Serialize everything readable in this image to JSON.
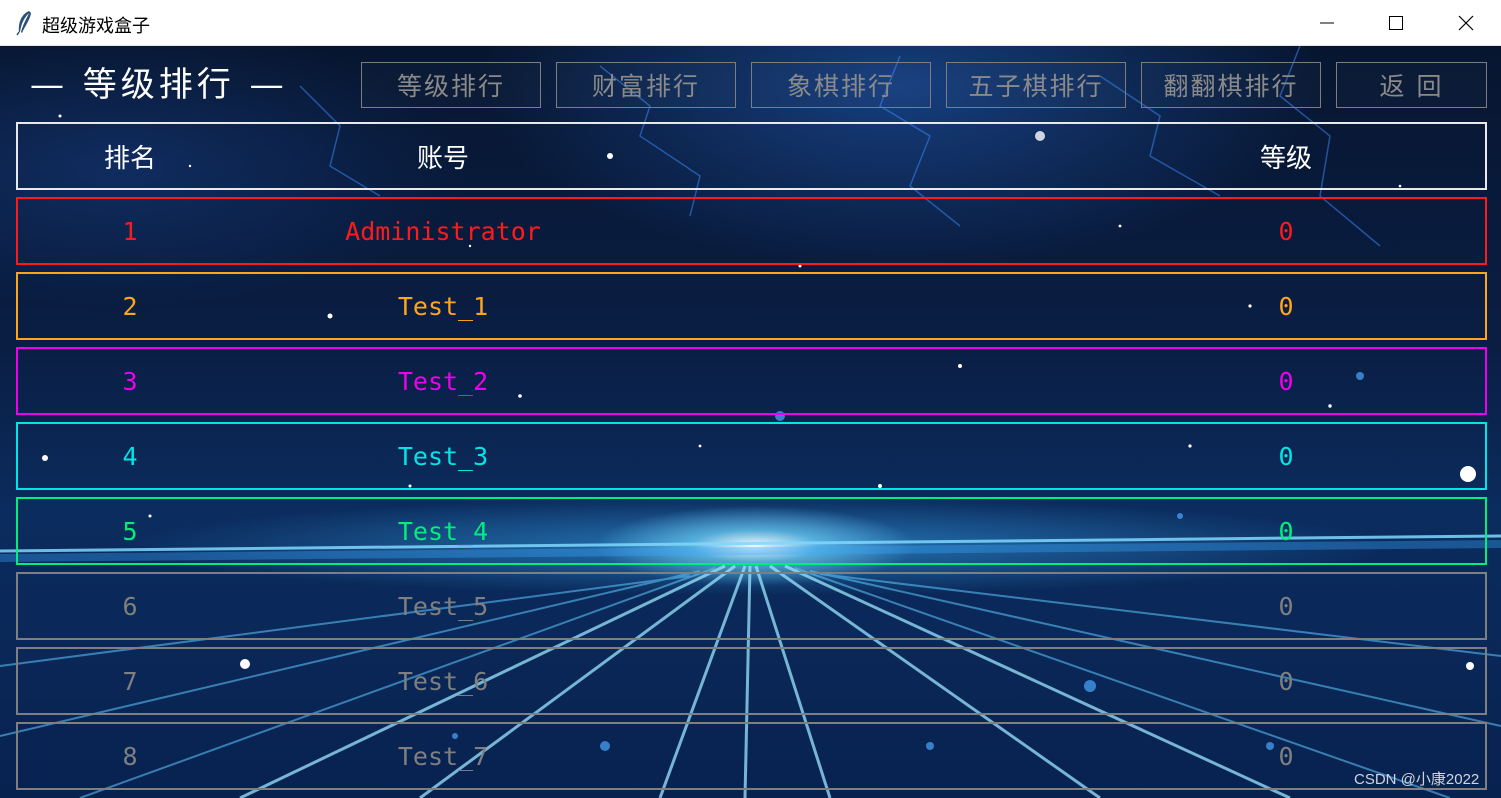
{
  "window": {
    "title": "超级游戏盒子",
    "icon": "feather-icon"
  },
  "header": {
    "title": "— 等级排行 —",
    "nav_buttons": [
      {
        "label": "等级排行"
      },
      {
        "label": "财富排行"
      },
      {
        "label": "象棋排行"
      },
      {
        "label": "五子棋排行"
      },
      {
        "label": "翻翻棋排行"
      },
      {
        "label": "返 回"
      }
    ]
  },
  "table": {
    "columns": {
      "rank": "排名",
      "account": "账号",
      "level": "等级"
    },
    "rows": [
      {
        "rank": "1",
        "account": "Administrator",
        "level": "0",
        "color": "#ff1a1a"
      },
      {
        "rank": "2",
        "account": "Test_1",
        "level": "0",
        "color": "#ffa51a"
      },
      {
        "rank": "3",
        "account": "Test_2",
        "level": "0",
        "color": "#ee00ee"
      },
      {
        "rank": "4",
        "account": "Test_3",
        "level": "0",
        "color": "#00e6e6"
      },
      {
        "rank": "5",
        "account": "Test_4",
        "level": "0",
        "color": "#00ee7a"
      },
      {
        "rank": "6",
        "account": "Test_5",
        "level": "0",
        "color": "#7f7f7f"
      },
      {
        "rank": "7",
        "account": "Test_6",
        "level": "0",
        "color": "#7f7f7f"
      },
      {
        "rank": "8",
        "account": "Test_7",
        "level": "0",
        "color": "#7f7f7f"
      }
    ]
  },
  "watermark": "CSDN @小康2022"
}
